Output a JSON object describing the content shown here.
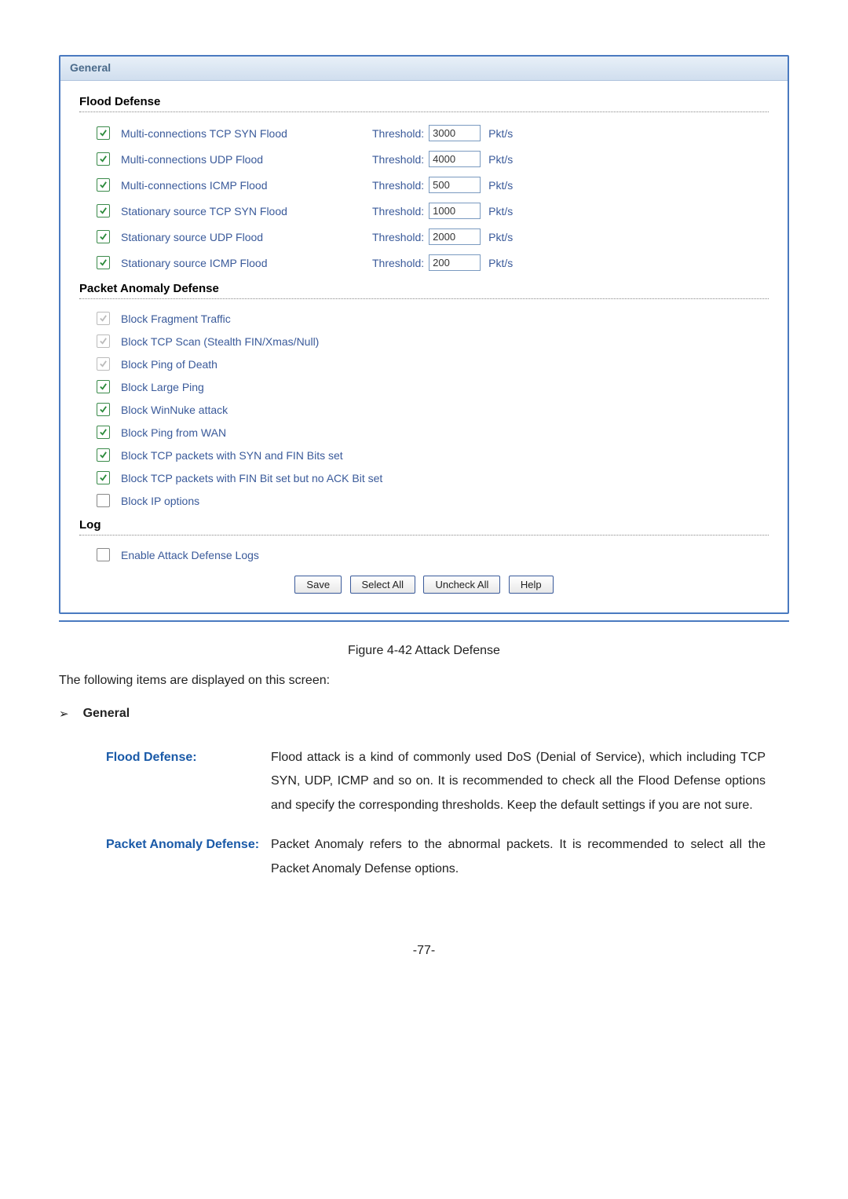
{
  "tab": "General",
  "sections": {
    "flood": {
      "title": "Flood Defense",
      "items": [
        {
          "label": "Multi-connections TCP SYN Flood",
          "checked": true,
          "threshold": "3000",
          "unit": "Pkt/s"
        },
        {
          "label": "Multi-connections UDP Flood",
          "checked": true,
          "threshold": "4000",
          "unit": "Pkt/s"
        },
        {
          "label": "Multi-connections ICMP Flood",
          "checked": true,
          "threshold": "500",
          "unit": "Pkt/s"
        },
        {
          "label": "Stationary source TCP SYN Flood",
          "checked": true,
          "threshold": "1000",
          "unit": "Pkt/s"
        },
        {
          "label": "Stationary source UDP Flood",
          "checked": true,
          "threshold": "2000",
          "unit": "Pkt/s"
        },
        {
          "label": "Stationary source ICMP Flood",
          "checked": true,
          "threshold": "200",
          "unit": "Pkt/s"
        }
      ],
      "threshold_label": "Threshold:"
    },
    "packet": {
      "title": "Packet Anomaly Defense",
      "items": [
        {
          "label": "Block Fragment Traffic",
          "checked": true,
          "disabled": true
        },
        {
          "label": "Block TCP Scan (Stealth FIN/Xmas/Null)",
          "checked": true,
          "disabled": true
        },
        {
          "label": "Block Ping of Death",
          "checked": true,
          "disabled": true
        },
        {
          "label": "Block Large Ping",
          "checked": true,
          "disabled": false
        },
        {
          "label": "Block WinNuke attack",
          "checked": true,
          "disabled": false
        },
        {
          "label": "Block Ping from WAN",
          "checked": true,
          "disabled": false
        },
        {
          "label": "Block TCP packets with SYN and FIN Bits set",
          "checked": true,
          "disabled": false
        },
        {
          "label": "Block TCP packets with FIN Bit set but no ACK Bit set",
          "checked": true,
          "disabled": false
        },
        {
          "label": "Block IP options",
          "checked": false,
          "disabled": false
        }
      ]
    },
    "log": {
      "title": "Log",
      "items": [
        {
          "label": "Enable Attack Defense Logs",
          "checked": false
        }
      ]
    }
  },
  "buttons": {
    "save": "Save",
    "select_all": "Select All",
    "uncheck_all": "Uncheck All",
    "help": "Help"
  },
  "figure_caption": "Figure 4-42 Attack Defense",
  "intro_text": "The following items are displayed on this screen:",
  "bullet_general": "General",
  "descriptions": [
    {
      "label": "Flood Defense:",
      "text": "Flood attack is a kind of commonly used DoS (Denial of Service), which including TCP SYN, UDP, ICMP and so on. It is recommended to check all the Flood Defense options and specify the corresponding thresholds. Keep the default settings if you are not sure."
    },
    {
      "label": "Packet Anomaly Defense:",
      "text": "Packet Anomaly refers to the abnormal packets. It is recommended to select all the Packet Anomaly Defense options."
    }
  ],
  "page_number": "-77-"
}
